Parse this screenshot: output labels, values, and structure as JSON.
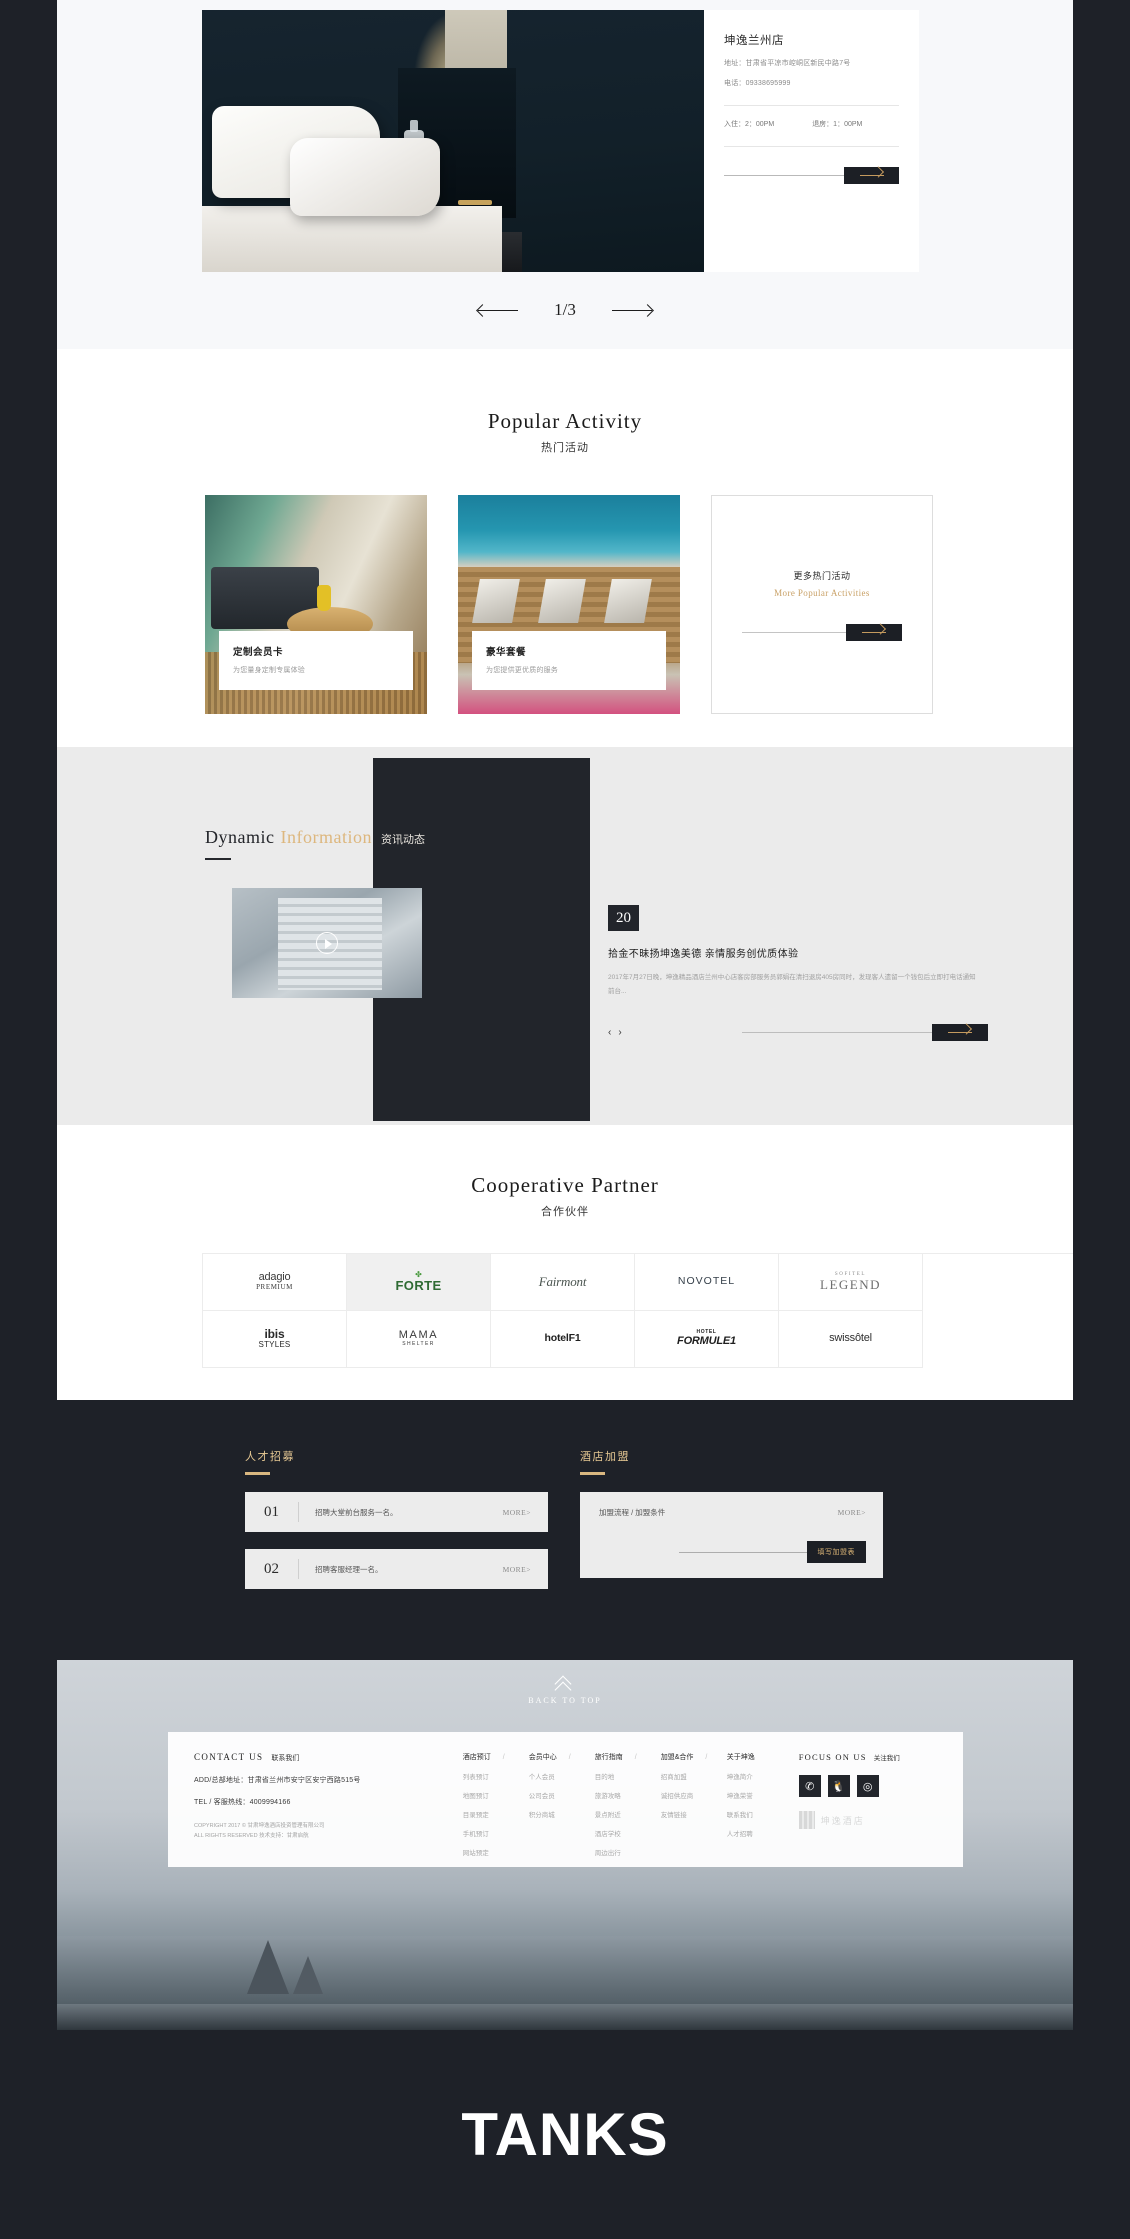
{
  "hero": {
    "hotel_name": "坤逸兰州店",
    "address": "地址：甘肃省平凉市崆峒区新民中路7号",
    "phone": "电话：09338695999",
    "checkin": "入住：2：00PM",
    "checkout": "退房：1：00PM",
    "carousel_counter": "1/3",
    "prev_label": "prev",
    "next_label": "next"
  },
  "activity": {
    "title_en": "Popular Activity",
    "title_cn": "热门活动",
    "cards": [
      {
        "title": "定制会员卡",
        "subtitle": "为您量身定制专属体验"
      },
      {
        "title": "豪华套餐",
        "subtitle": "为您提供更优质的服务"
      }
    ],
    "more": {
      "cn": "更多热门活动",
      "en": "More Popular Activities"
    }
  },
  "dynamic": {
    "title_word1": "Dynamic",
    "title_word2": "Information",
    "title_cn": "资讯动态",
    "date": "20",
    "news_title": "拾金不昧扬坤逸美德 亲情服务创优质体验",
    "news_desc": "2017年7月27日晚，坤逸精品酒店兰州中心店客房部服务员郭娟在清扫退房405房同时，发现客人遗留一个钱包后立即打电话通知前台...",
    "pager_prev": "‹",
    "pager_next": "›"
  },
  "partner": {
    "title_en": "Cooperative Partner",
    "title_cn": "合作伙伴",
    "logos": [
      {
        "name": "adagio",
        "sub": "PREMIUM",
        "style": "adagio",
        "highlight": false
      },
      {
        "name": "FORTE",
        "sub": "",
        "style": "forte",
        "highlight": true
      },
      {
        "name": "Fairmont",
        "sub": "",
        "style": "fairmont",
        "highlight": false
      },
      {
        "name": "NOVOTEL",
        "sub": "",
        "style": "novotel",
        "highlight": false
      },
      {
        "name": "LEGEND",
        "sub": "SOFITEL",
        "style": "legend",
        "highlight": false
      },
      {
        "name": "ibis",
        "sub": "STYLES",
        "style": "ibis",
        "highlight": false
      },
      {
        "name": "MAMA",
        "sub": "SHELTER",
        "style": "mama",
        "highlight": false
      },
      {
        "name": "hotelF1",
        "sub": "",
        "style": "hotelf1",
        "highlight": false
      },
      {
        "name": "FORMULE1",
        "sub": "HOTEL",
        "style": "formule",
        "highlight": false
      },
      {
        "name": "swissôtel",
        "sub": "",
        "style": "swiss",
        "highlight": false
      }
    ]
  },
  "recruit": {
    "heading": "人才招募",
    "jobs": [
      {
        "no": "01",
        "text": "招聘大堂前台服务一名。",
        "more": "MORE>"
      },
      {
        "no": "02",
        "text": "招聘客服经理一名。",
        "more": "MORE>"
      }
    ]
  },
  "franchise": {
    "heading": "酒店加盟",
    "text": "加盟流程 / 加盟条件",
    "more": "MORE>",
    "button": "填写加盟表"
  },
  "footer": {
    "back_to_top": "BACK TO TOP",
    "contact": {
      "title_en": "CONTACT US",
      "title_cn": "联系我们",
      "address": "ADD/总部地址：甘肃省兰州市安宁区安宁西路515号",
      "tel": "TEL / 客服热线：4009994166",
      "copyright1": "COPYRIGHT 2017 © 甘肃坤逸酒店投资管理有限公司",
      "copyright2": "ALL RIGHTS RESERVED  技术支持：甘肃启航"
    },
    "columns": [
      {
        "heading": "酒店预订",
        "items": [
          "列表预订",
          "地图预订",
          "目录预定",
          "手机预订",
          "网站预定"
        ]
      },
      {
        "heading": "会员中心",
        "items": [
          "个人会员",
          "公司会员",
          "积分商城"
        ]
      },
      {
        "heading": "旅行指南",
        "items": [
          "目的地",
          "旅游攻略",
          "景点附近",
          "酒店学校",
          "周边出行"
        ]
      },
      {
        "heading": "加盟&合作",
        "items": [
          "招商加盟",
          "诚招供应商",
          "友情链接"
        ]
      },
      {
        "heading": "关于坤逸",
        "items": [
          "坤逸简介",
          "坤逸荣誉",
          "联系我们",
          "人才招聘"
        ]
      }
    ],
    "column_separator": "/",
    "social": {
      "title_en": "FOCUS ON US",
      "title_cn": "关注我们",
      "icons": [
        "wechat-icon",
        "qq-icon",
        "weibo-icon"
      ],
      "brand_name": "坤逸酒店"
    }
  },
  "bottom": {
    "tanks": "TANKS"
  },
  "colors": {
    "dark": "#1e2128",
    "gold": "#d9b780",
    "panel_grey": "#ececec"
  }
}
